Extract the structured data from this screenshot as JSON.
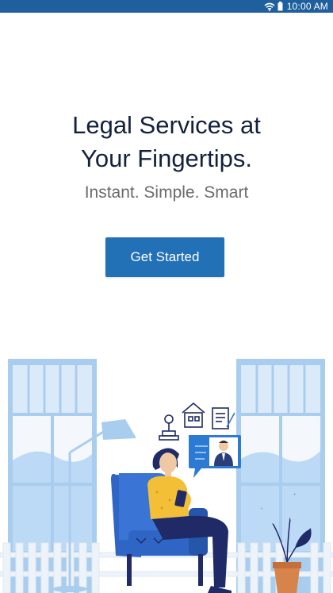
{
  "status_bar": {
    "time": "10:00 AM",
    "icons": [
      "wifi-icon",
      "battery-icon"
    ],
    "background": "#1f5f9e"
  },
  "hero": {
    "title_line1": "Legal Services at",
    "title_line2": "Your Fingertips.",
    "subtitle": "Instant. Simple. Smart"
  },
  "cta": {
    "label": "Get Started",
    "color": "#2270b5"
  },
  "illustration": {
    "icons": [
      "stamp-icon",
      "house-document-icon",
      "contract-icon",
      "lawyer-avatar-icon",
      "phone-icon"
    ],
    "colors": {
      "window": "#bcd9f5",
      "window_frame": "#a9cdee",
      "chair": "#2f66c6",
      "shirt": "#f3bf36",
      "pants": "#1f2a66",
      "chat_bubble": "#2c7ad2",
      "pot": "#d7844c",
      "fence": "#eef3fa"
    }
  }
}
